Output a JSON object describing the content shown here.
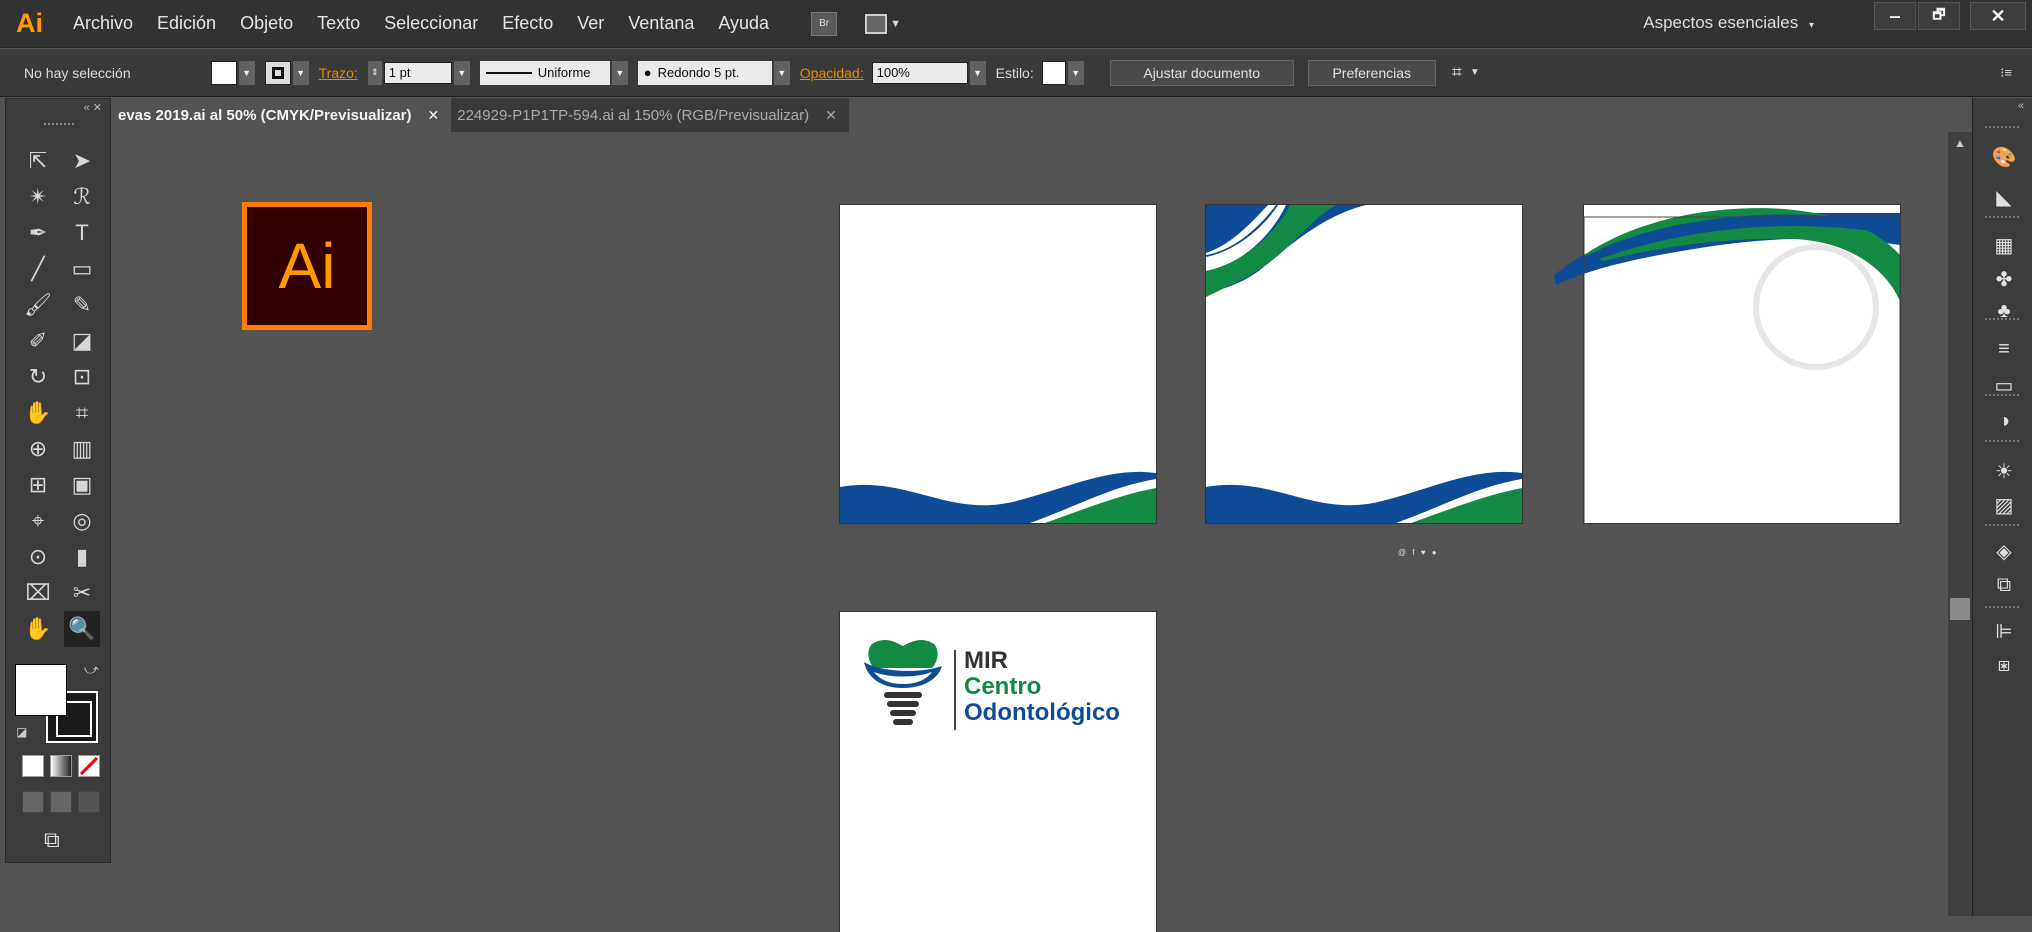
{
  "app": {
    "logo": "Ai"
  },
  "menu": [
    "Archivo",
    "Edición",
    "Objeto",
    "Texto",
    "Seleccionar",
    "Efecto",
    "Ver",
    "Ventana",
    "Ayuda"
  ],
  "bridge_label": "Br",
  "workspace": "Aspectos esenciales",
  "window_buttons": {
    "minimize": "‒",
    "restore": "🗗",
    "close": "✕"
  },
  "control": {
    "selection": "No hay selección",
    "stroke_label": "Trazo:",
    "stroke_value": "1 pt",
    "profile": "Uniforme",
    "brush": "Redondo 5 pt.",
    "opacity_label": "Opacidad:",
    "opacity_value": "100%",
    "style_label": "Estilo:",
    "fit_button": "Ajustar documento",
    "prefs_button": "Preferencias"
  },
  "tabs": [
    {
      "label": "evas 2019.ai al 50% (CMYK/Previsualizar)",
      "close": "✕"
    },
    {
      "label": "224929-P1P1TP-594.ai al 150% (RGB/Previsualizar)",
      "close": "✕"
    }
  ],
  "canvas": {
    "ai_logo": "Ai",
    "social_icons": "@ f ♥ ●",
    "logo_text": {
      "line1": "MIR",
      "line2": "Centro",
      "line3": "Odontológico"
    }
  },
  "colors": {
    "blue": "#0f4c97",
    "green": "#138a43",
    "orange": "#ff9a00"
  },
  "tool_icons": [
    "selection-icon",
    "direct-selection-icon",
    "magic-wand-icon",
    "lasso-icon",
    "pen-icon",
    "type-icon",
    "line-icon",
    "rectangle-icon",
    "paintbrush-icon",
    "pencil-icon",
    "shaper-icon",
    "eraser-icon",
    "rotate-icon",
    "scale-icon",
    "warp-icon",
    "free-transform-icon",
    "shape-builder-icon",
    "perspective-grid-icon",
    "mesh-icon",
    "gradient-icon",
    "eyedropper-icon",
    "blend-icon",
    "symbol-sprayer-icon",
    "column-graph-icon",
    "artboard-icon",
    "slice-icon",
    "hand-icon",
    "zoom-icon"
  ],
  "tool_glyphs": [
    "⇱",
    "➤",
    "✴",
    "ℛ",
    "✒",
    "T",
    "╱",
    "▭",
    "🖌",
    "✎",
    "✐",
    "◪",
    "↻",
    "⊡",
    "✋",
    "⌗",
    "⊕",
    "▥",
    "⊞",
    "▣",
    "⌖",
    "◎",
    "⊙",
    "▮",
    "⌧",
    "✂",
    "✋",
    "🔍"
  ],
  "right_icons": [
    "color-guide-icon",
    "color-icon",
    "swatches-icon",
    "brushes-icon",
    "symbols-icon",
    "stroke-icon",
    "gradient-panel-icon",
    "transparency-icon",
    "appearance-icon",
    "graphic-styles-icon",
    "layers-icon",
    "artboards-icon",
    "align-icon",
    "pathfinder-icon"
  ],
  "right_glyphs": [
    "🎨",
    "◣",
    "▦",
    "✤",
    "♣",
    "≡",
    "▭",
    "◑",
    "☀",
    "▨",
    "◈",
    "⧉",
    "⊫",
    "⧆"
  ]
}
